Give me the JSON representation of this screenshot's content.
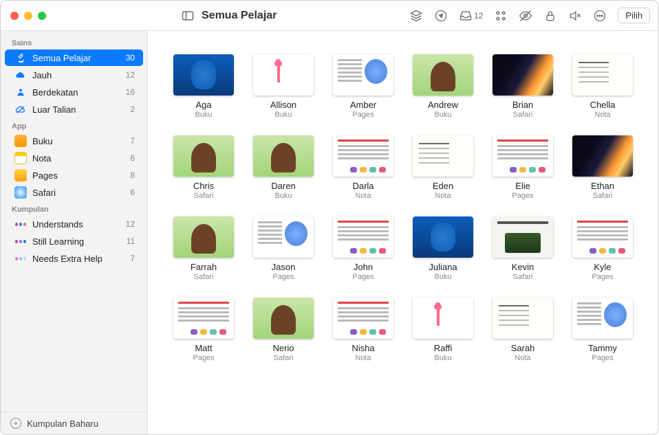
{
  "titlebar": {
    "title": "Semua Pelajar",
    "inbox_count": "12",
    "select_button": "Pilih"
  },
  "sidebar": {
    "sections": {
      "class": "Sains",
      "app": "App",
      "group": "Kumpulan"
    },
    "class_items": [
      {
        "label": "Semua Pelajar",
        "count": "30"
      },
      {
        "label": "Jauh",
        "count": "12"
      },
      {
        "label": "Berdekatan",
        "count": "16"
      },
      {
        "label": "Luar Talian",
        "count": "2"
      }
    ],
    "app_items": [
      {
        "label": "Buku",
        "count": "7"
      },
      {
        "label": "Nota",
        "count": "6"
      },
      {
        "label": "Pages",
        "count": "8"
      },
      {
        "label": "Safari",
        "count": "6"
      }
    ],
    "group_items": [
      {
        "label": "Understands",
        "count": "12"
      },
      {
        "label": "Still Learning",
        "count": "11"
      },
      {
        "label": "Needs Extra Help",
        "count": "7"
      }
    ],
    "new_group": "Kumpulan Baharu"
  },
  "students": [
    {
      "name": "Aga",
      "app": "Buku"
    },
    {
      "name": "Allison",
      "app": "Buku"
    },
    {
      "name": "Amber",
      "app": "Pages"
    },
    {
      "name": "Andrew",
      "app": "Buku"
    },
    {
      "name": "Brian",
      "app": "Safari"
    },
    {
      "name": "Chella",
      "app": "Nota"
    },
    {
      "name": "Chris",
      "app": "Safari"
    },
    {
      "name": "Daren",
      "app": "Buku"
    },
    {
      "name": "Darla",
      "app": "Nota"
    },
    {
      "name": "Eden",
      "app": "Nota"
    },
    {
      "name": "Elie",
      "app": "Pages"
    },
    {
      "name": "Ethan",
      "app": "Safari"
    },
    {
      "name": "Farrah",
      "app": "Safari"
    },
    {
      "name": "Jason",
      "app": "Pages"
    },
    {
      "name": "John",
      "app": "Pages"
    },
    {
      "name": "Juliana",
      "app": "Buku"
    },
    {
      "name": "Kevin",
      "app": "Safari"
    },
    {
      "name": "Kyle",
      "app": "Pages"
    },
    {
      "name": "Matt",
      "app": "Pages"
    },
    {
      "name": "Nerio",
      "app": "Safari"
    },
    {
      "name": "Nisha",
      "app": "Nota"
    },
    {
      "name": "Raffi",
      "app": "Buku"
    },
    {
      "name": "Sarah",
      "app": "Nota"
    },
    {
      "name": "Tammy",
      "app": "Pages"
    }
  ],
  "thumb_class": {
    "0": "th-whale",
    "1": "th-flamingo",
    "2": "th-pages",
    "3": "th-mammoth",
    "4": "th-space",
    "5": "th-nota",
    "6": "th-mammoth",
    "7": "th-mammoth",
    "8": "th-pages2",
    "9": "th-nota",
    "10": "th-pages2",
    "11": "th-space",
    "12": "th-mammoth",
    "13": "th-pages",
    "14": "th-pages2",
    "15": "th-whale",
    "16": "th-safari2",
    "17": "th-pages2",
    "18": "th-pages2",
    "19": "th-mammoth",
    "20": "th-pages2",
    "21": "th-flamingo",
    "22": "th-nota",
    "23": "th-pages"
  }
}
